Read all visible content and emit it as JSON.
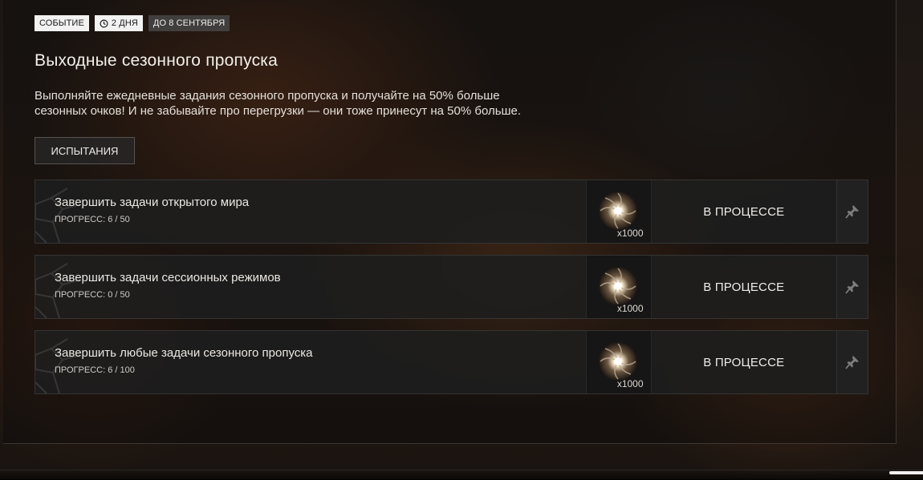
{
  "event": {
    "type_badge": "СОБЫТИЕ",
    "duration_badge": "2 ДНЯ",
    "deadline_badge": "ДО 8 СЕНТЯБРЯ",
    "title": "Выходные сезонного пропуска",
    "description": "Выполняйте ежедневные задания сезонного пропуска и получайте на 50% больше сезонных очков! И не забывайте про перегрузки — они тоже принесут на 50% больше."
  },
  "tabs": [
    {
      "label": "ИСПЫТАНИЯ"
    }
  ],
  "tasks": [
    {
      "title": "Завершить задачи открытого мира",
      "progress": "ПРОГРЕСС: 6 / 50",
      "reward_qty": "x1000",
      "status": "В ПРОЦЕССЕ"
    },
    {
      "title": "Завершить задачи сессионных режимов",
      "progress": "ПРОГРЕСС: 0 / 50",
      "reward_qty": "x1000",
      "status": "В ПРОЦЕССЕ"
    },
    {
      "title": "Завершить любые задачи сезонного пропуска",
      "progress": "ПРОГРЕСС: 6 / 100",
      "reward_qty": "x1000",
      "status": "В ПРОЦЕССЕ"
    }
  ],
  "icons": {
    "clock": "clock-icon",
    "reward": "season-points-orb-icon",
    "pin": "pin-icon"
  },
  "colors": {
    "badge_light": "#f2f2f2",
    "badge_dark": "#464646",
    "row_bg": "#1e1e1e"
  }
}
